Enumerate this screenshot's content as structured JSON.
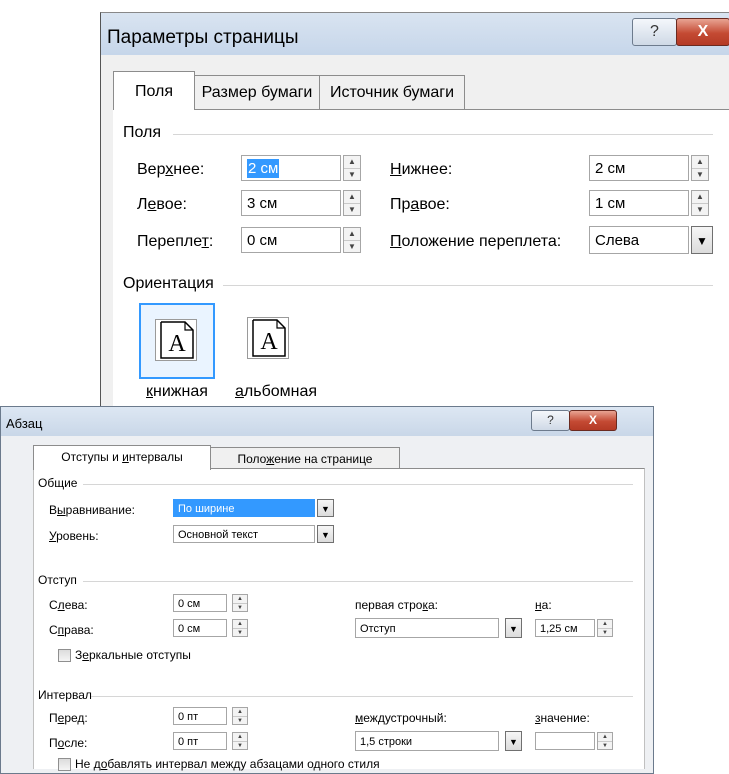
{
  "page_setup_dialog": {
    "title": "Параметры страницы",
    "help_label": "?",
    "close_label": "X",
    "tabs": [
      {
        "label": "Поля",
        "active": true
      },
      {
        "label": "Размер бумаги",
        "active": false
      },
      {
        "label": "Источник бумаги",
        "active": false
      }
    ],
    "margins_section": {
      "title": "Поля",
      "top": {
        "label": "Верхнее:",
        "value": "2 см"
      },
      "bottom": {
        "label": "Нижнее:",
        "value": "2 см"
      },
      "left": {
        "label": "Левое:",
        "value": "3 см"
      },
      "right": {
        "label": "Правое:",
        "value": "1 см"
      },
      "gutter": {
        "label": "Переплет:",
        "value": "0 см"
      },
      "gutter_position": {
        "label": "Положение переплета:",
        "value": "Слева"
      }
    },
    "orientation_section": {
      "title": "Ориентация",
      "portrait": {
        "label": "книжная",
        "icon_glyph": "A",
        "selected": true
      },
      "landscape": {
        "label": "альбомная",
        "icon_glyph": "A",
        "selected": false
      }
    }
  },
  "paragraph_dialog": {
    "title": "Абзац",
    "help_label": "?",
    "close_label": "X",
    "tabs": [
      {
        "label": "Отступы и интервалы",
        "active": true
      },
      {
        "label": "Положение на странице",
        "active": false
      }
    ],
    "general_section": {
      "title": "Общие",
      "alignment": {
        "label": "Выравнивание:",
        "value": "По ширине"
      },
      "level": {
        "label": "Уровень:",
        "value": "Основной текст"
      }
    },
    "indent_section": {
      "title": "Отступ",
      "left": {
        "label": "Слева:",
        "value": "0 см"
      },
      "right": {
        "label": "Справа:",
        "value": "0 см"
      },
      "first_line": {
        "label": "первая строка:",
        "value": "Отступ"
      },
      "by": {
        "label": "на:",
        "value": "1,25 см"
      },
      "mirror": {
        "label": "Зеркальные отступы",
        "checked": false
      }
    },
    "spacing_section": {
      "title": "Интервал",
      "before": {
        "label": "Перед:",
        "value": "0 пт"
      },
      "after": {
        "label": "После:",
        "value": "0 пт"
      },
      "line_spacing": {
        "label": "междустрочный:",
        "value": "1,5 строки"
      },
      "at": {
        "label": "значение:",
        "value": ""
      },
      "dont_add_space": {
        "label": "Не добавлять интервал между абзацами одного стиля",
        "checked": false
      }
    }
  },
  "colors": {
    "selection": "#3399ff",
    "close_button": "#c44a33",
    "titlebar": "#c9d7e8"
  }
}
